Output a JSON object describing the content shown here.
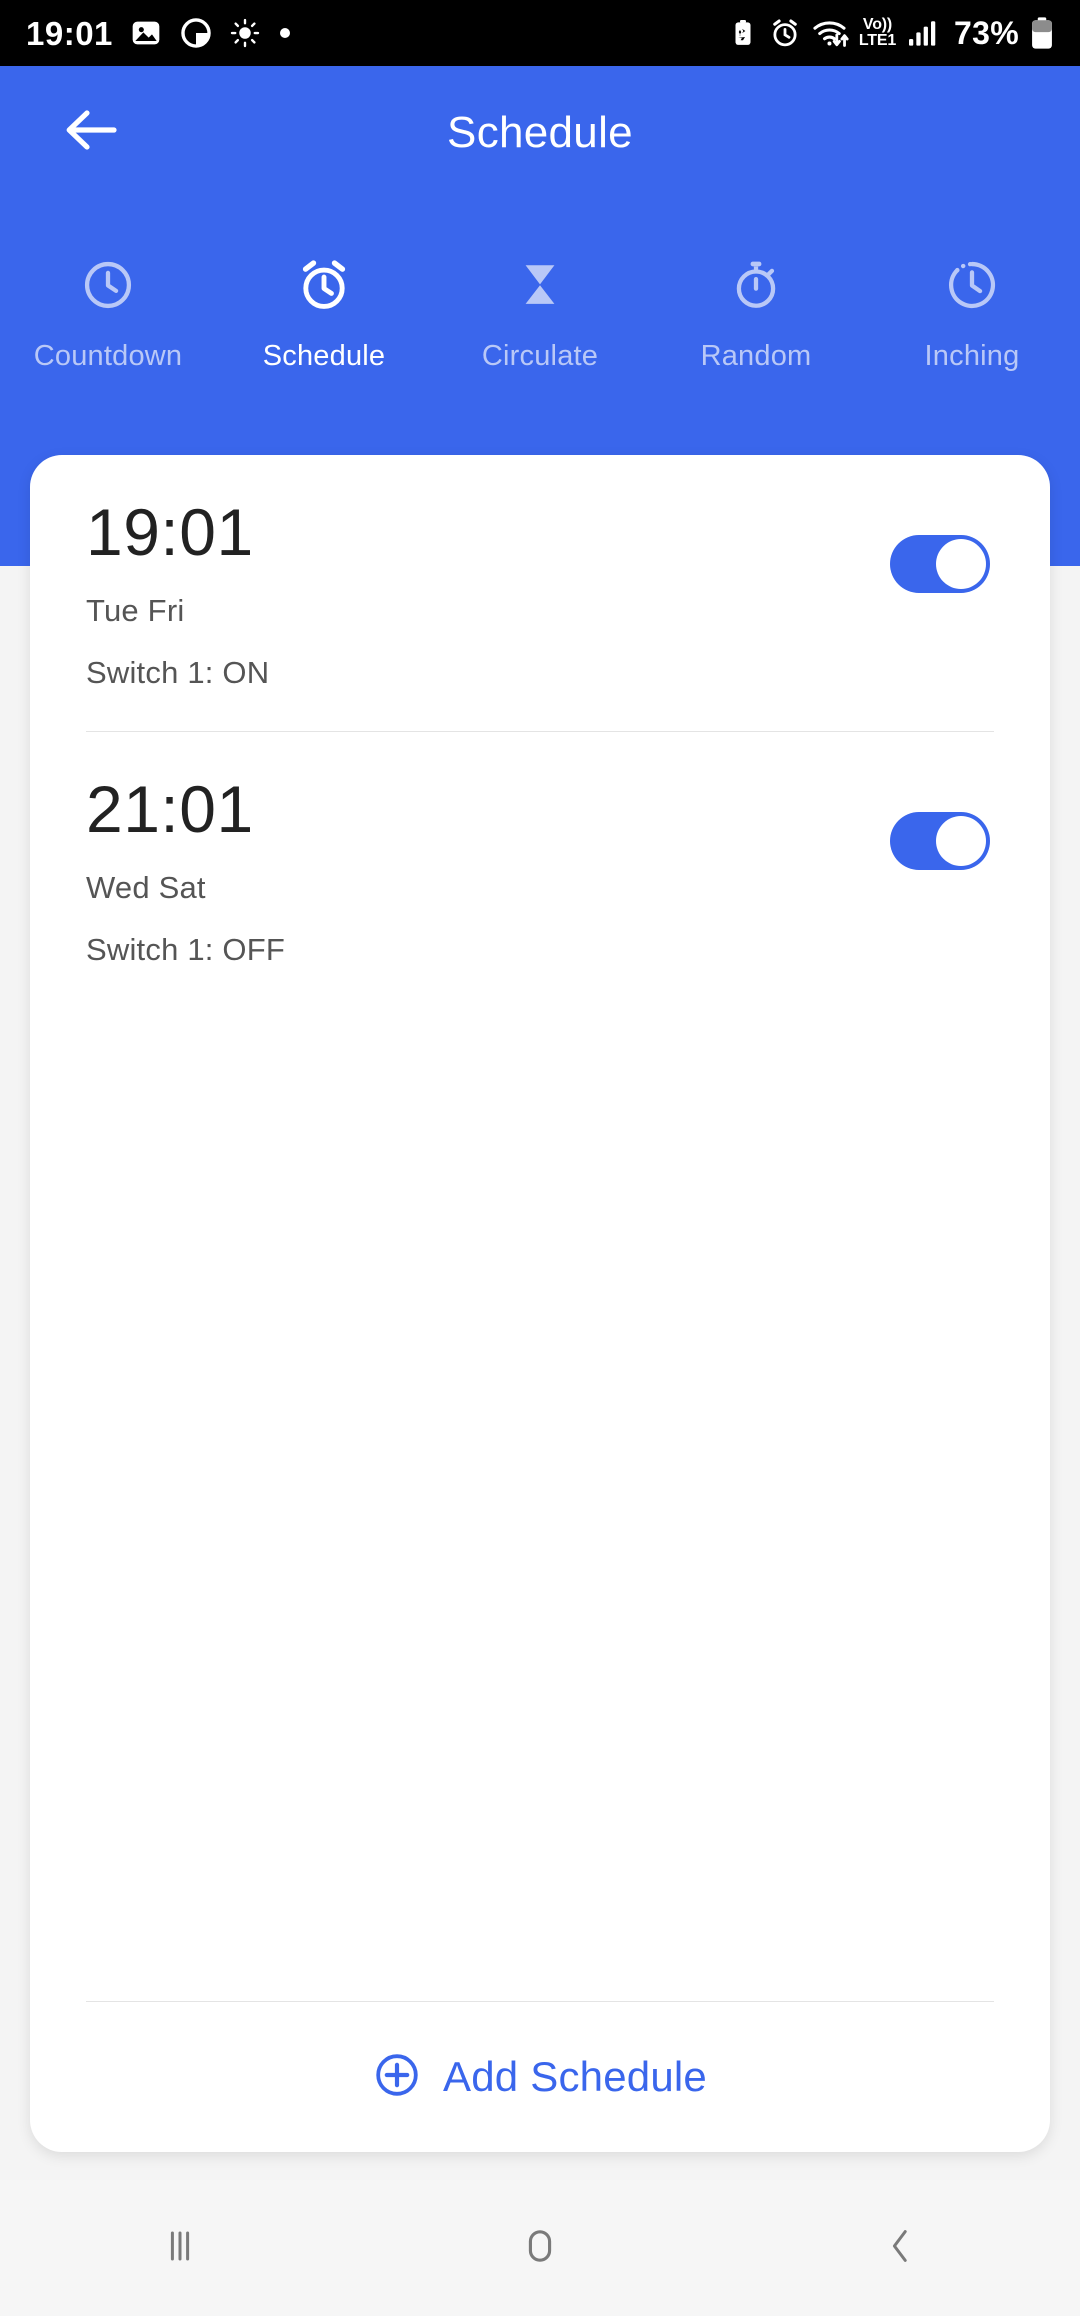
{
  "status_bar": {
    "time": "19:01",
    "left_icons": [
      "image-icon",
      "circle-icon",
      "brightness-icon",
      "dot-icon"
    ],
    "right_icons": [
      "battery-saver-icon",
      "alarm-icon",
      "wifi-icon",
      "signal-icon"
    ],
    "volte_label_top": "Vo))",
    "volte_label_bottom": "LTE1",
    "battery_percent": "73%"
  },
  "header": {
    "title": "Schedule",
    "back_icon": "arrow-left-icon",
    "background_color": "#3a66ec"
  },
  "tabs": [
    {
      "label": "Countdown",
      "icon": "clock-icon",
      "active": false
    },
    {
      "label": "Schedule",
      "icon": "alarm-clock-icon",
      "active": true
    },
    {
      "label": "Circulate",
      "icon": "hourglass-icon",
      "active": false
    },
    {
      "label": "Random",
      "icon": "stopwatch-icon",
      "active": false
    },
    {
      "label": "Inching",
      "icon": "dashed-clock-icon",
      "active": false
    }
  ],
  "schedules": [
    {
      "time": "19:01",
      "days": "Tue Fri",
      "action": "Switch 1: ON",
      "enabled": true
    },
    {
      "time": "21:01",
      "days": "Wed Sat",
      "action": "Switch 1: OFF",
      "enabled": true
    }
  ],
  "add_schedule": {
    "label": "Add Schedule",
    "icon": "plus-circle-icon",
    "color": "#3a66ec"
  },
  "nav_bar": {
    "recents_icon": "recents-icon",
    "home_icon": "home-icon",
    "back_icon": "back-chevron-icon"
  },
  "colors": {
    "accent": "#3a66ec",
    "card_background": "#ffffff",
    "page_background": "#f4f4f4",
    "inactive_tab_text": "#b9c8f7"
  }
}
